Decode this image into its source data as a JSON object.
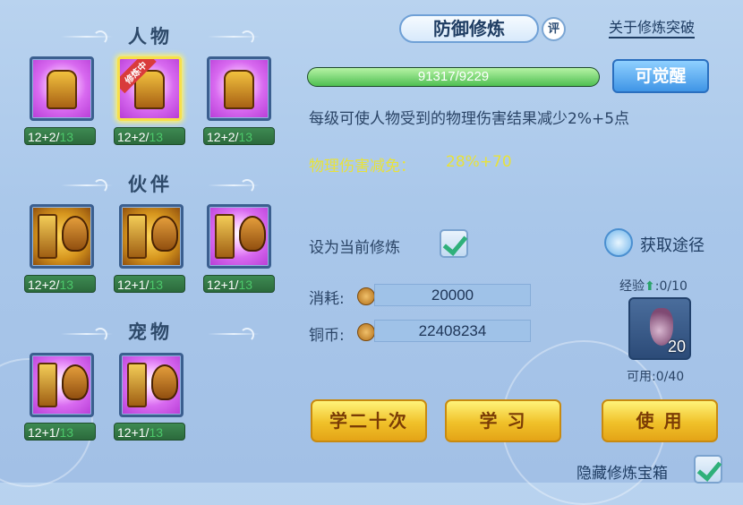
{
  "sections": {
    "character": "人物",
    "partner": "伙伴",
    "pet": "宠物"
  },
  "slots": {
    "character": [
      {
        "level": "12+2/",
        "level_fade": "13",
        "selected": false
      },
      {
        "level": "12+2/",
        "level_fade": "13",
        "selected": true,
        "badge": "修炼中"
      },
      {
        "level": "12+2/",
        "level_fade": "13",
        "selected": false
      }
    ],
    "partner": [
      {
        "level": "12+2/",
        "level_fade": "13"
      },
      {
        "level": "12+1/",
        "level_fade": "13"
      },
      {
        "level": "12+1/",
        "level_fade": "13"
      }
    ],
    "pet": [
      {
        "level": "12+1/",
        "level_fade": "13"
      },
      {
        "level": "12+1/",
        "level_fade": "13"
      }
    ]
  },
  "panel": {
    "title": "防御修炼",
    "rate_label": "评",
    "about_link": "关于修炼突破",
    "progress_text": "91317/9229",
    "progress_fraction": 1.0,
    "awaken_button": "可觉醒",
    "description": "每级可使人物受到的物理伤害结果减少2%+5点",
    "effect_label": "物理伤害减免：",
    "effect_value": "28%+70",
    "set_current_label": "设为当前修炼",
    "set_current_checked": true,
    "obtain_route": "获取途径",
    "cost_label": "消耗:",
    "cost_value": "20000",
    "coins_label": "铜币:",
    "coins_value": "22408234",
    "exp_label": "经验",
    "exp_value": ":0/10",
    "item_count": "20",
    "available": "可用:0/40",
    "btn_learn20": "学二十次",
    "btn_learn": "学 习",
    "btn_use": "使 用",
    "hide_box_label": "隐藏修炼宝箱",
    "hide_box_checked": true
  },
  "colors": {
    "effect_text": "#e8e23a",
    "progress_fill": "#4fbf52",
    "gold_button": "#f0c129",
    "blue_button": "#3f95e6"
  }
}
